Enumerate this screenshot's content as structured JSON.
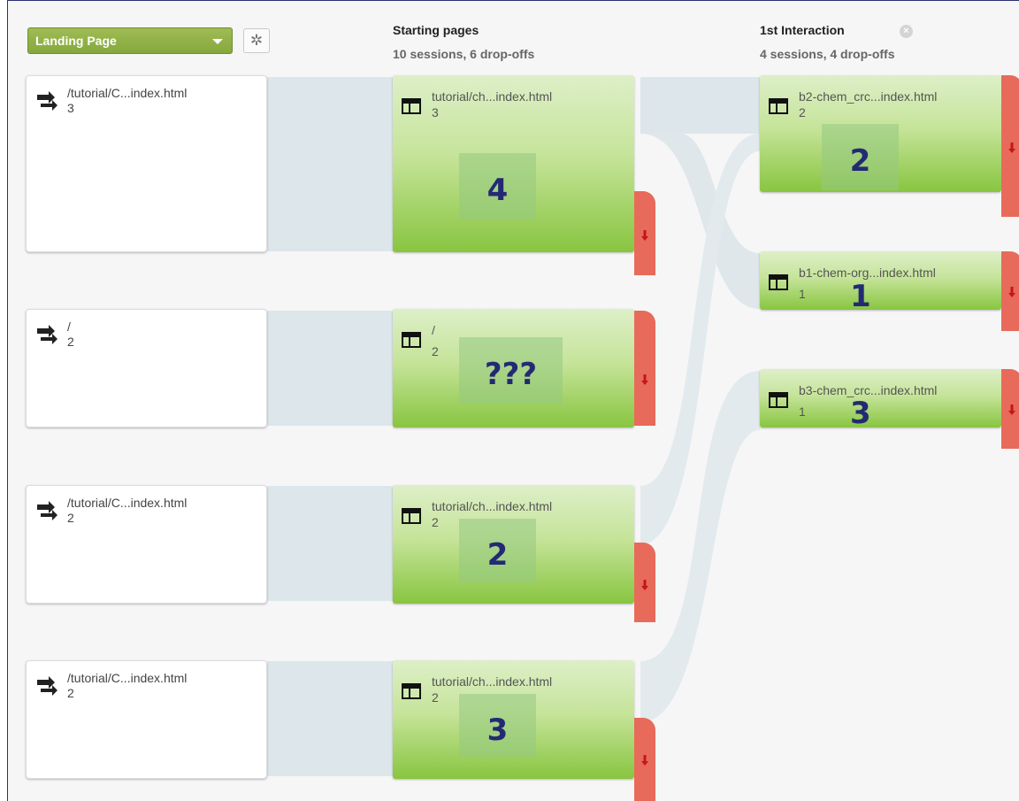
{
  "header": {
    "dimension_label": "Landing Page",
    "columns": [
      {
        "title": "Starting pages",
        "subtitle": "10 sessions, 6 drop-offs"
      },
      {
        "title": "1st Interaction",
        "subtitle": "4 sessions, 4 drop-offs"
      }
    ]
  },
  "landing_nodes": [
    {
      "title": "/tutorial/C...index.html",
      "count": "3"
    },
    {
      "title": "/",
      "count": "2"
    },
    {
      "title": "/tutorial/C...index.html",
      "count": "2"
    },
    {
      "title": "/tutorial/C...index.html",
      "count": "2"
    }
  ],
  "starting_nodes": [
    {
      "title": "tutorial/ch...index.html",
      "count": "3",
      "annotation": "4"
    },
    {
      "title": "/",
      "count": "2",
      "annotation": "???"
    },
    {
      "title": "tutorial/ch...index.html",
      "count": "2",
      "annotation": "2"
    },
    {
      "title": "tutorial/ch...index.html",
      "count": "2",
      "annotation": "3"
    }
  ],
  "interaction_nodes": [
    {
      "title": "b2-chem_crc...index.html",
      "count": "2",
      "annotation": "2"
    },
    {
      "title": "b1-chem-org...index.html",
      "count": "1",
      "annotation": "1"
    },
    {
      "title": "b3-chem_crc...index.html",
      "count": "1",
      "annotation": "3"
    }
  ],
  "colors": {
    "node_green": "#88c540",
    "dropoff_red": "#e86a5a",
    "flow": "#dde6ea",
    "annotation": "#232a73"
  },
  "icons": [
    "flow-arrows-icon",
    "page-layout-icon",
    "gear-icon",
    "close-icon",
    "drop-arrow-icon",
    "chevron-down-icon"
  ]
}
